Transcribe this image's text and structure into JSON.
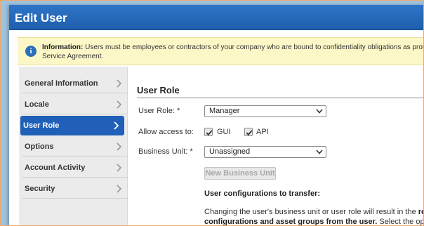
{
  "dialog": {
    "title": "Edit User"
  },
  "info": {
    "heading": "Information:",
    "line1": "Users must be employees or contractors of your company who are bound to confidentiality obligations as protective as th",
    "line2": "Service Agreement."
  },
  "sidebar": {
    "items": [
      {
        "label": "General Information",
        "active": false
      },
      {
        "label": "Locale",
        "active": false
      },
      {
        "label": "User Role",
        "active": true
      },
      {
        "label": "Options",
        "active": false
      },
      {
        "label": "Account Activity",
        "active": false
      },
      {
        "label": "Security",
        "active": false
      }
    ]
  },
  "user_role": {
    "section_title": "User Role",
    "role_label": "User Role: *",
    "role_value": "Manager",
    "access_label": "Allow access to:",
    "gui_label": "GUI",
    "api_label": "API",
    "gui_checked": true,
    "api_checked": true,
    "bu_label": "Business Unit: *",
    "bu_value": "Unassigned",
    "new_bu_button": "New Business Unit",
    "transfer_title": "User configurations to transfer:",
    "para_line1_a": "Changing the user's business unit or user role will result in the ",
    "para_line1_b": "removal",
    "para_line2_a": "configurations and asset groups from the user.",
    "para_line2_b": " Select the options be"
  },
  "colors": {
    "title_bar": "#2467bd",
    "active_nav": "#2060b8",
    "info_bg": "#fbf7c7",
    "sidebar_bg": "#ebebeb"
  }
}
